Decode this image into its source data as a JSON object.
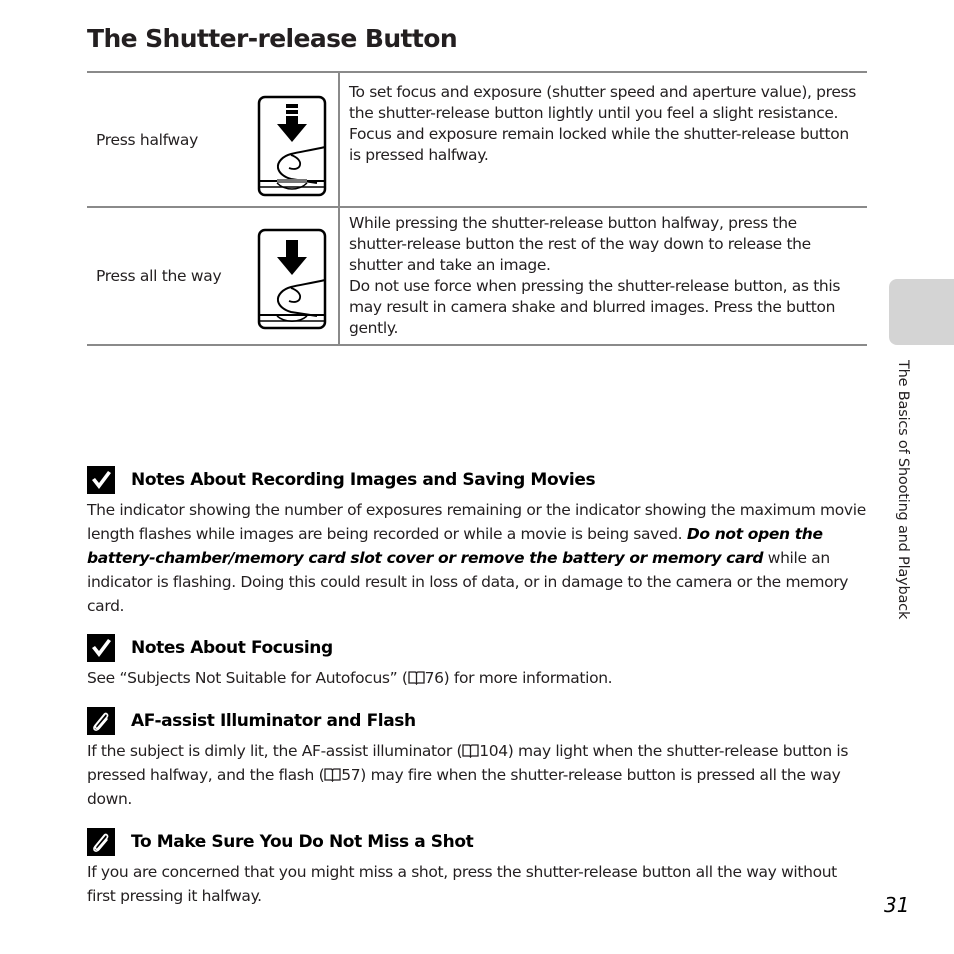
{
  "page": {
    "title": "The Shutter-release Button",
    "side_tab": "The Basics of Shooting and Playback",
    "page_number": "31"
  },
  "table": {
    "rows": [
      {
        "label": "Press halfway",
        "icon": "press-halfway-icon",
        "description": "To set focus and exposure (shutter speed and aperture value), press the shutter-release button lightly until you feel a slight resistance. Focus and exposure remain locked while the shutter-release button is pressed halfway."
      },
      {
        "label": "Press all the way",
        "icon": "press-all-the-way-icon",
        "description_1": "While pressing the shutter-release button halfway, press the shutter-release button the rest of the way down to release the shutter and take an image.",
        "description_2": "Do not use force when pressing the shutter-release button, as this may result in camera shake and blurred images. Press the button gently."
      }
    ]
  },
  "notes": [
    {
      "icon": "checkmark-icon",
      "title": "Notes About Recording Images and Saving Movies",
      "body_1": "The indicator showing the number of exposures remaining or the indicator showing the maximum movie length flashes while images are being recorded or while a movie is being saved. ",
      "body_emphasis": "Do not open the battery-chamber/memory card slot cover or remove the battery or memory card",
      "body_2": " while an indicator is flashing. Doing this could result in loss of data, or in damage to the camera or the memory card."
    },
    {
      "icon": "checkmark-icon",
      "title": "Notes About Focusing",
      "body_1": "See “Subjects Not Suitable for Autofocus” (",
      "ref": "76",
      "body_2": ") for more information."
    },
    {
      "icon": "paperclip-icon",
      "title": "AF-assist Illuminator and Flash",
      "body_1": "If the subject is dimly lit, the AF-assist illuminator (",
      "ref_1": "104",
      "body_2": ") may light when the shutter-release button is pressed halfway, and the flash (",
      "ref_2": "57",
      "body_3": ") may fire when the shutter-release button is pressed all the way down."
    },
    {
      "icon": "paperclip-icon",
      "title": "To Make Sure You Do Not Miss a Shot",
      "body_1": "If you are concerned that you might miss a shot, press the shutter-release button all the way without first pressing it halfway."
    }
  ]
}
